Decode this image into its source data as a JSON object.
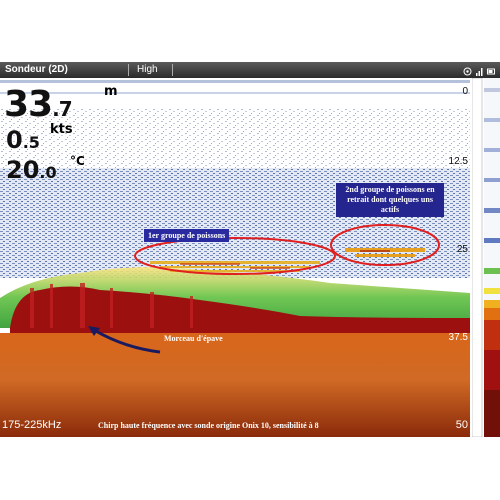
{
  "window": {
    "title": "Sondeur (2D)",
    "mode": "High",
    "icons": [
      "gps-icon",
      "signal-icon",
      "battery-icon"
    ]
  },
  "readouts": {
    "depth_int": "33",
    "depth_dec": ".7",
    "depth_unit": "m",
    "speed_int": "0",
    "speed_dec": ".5",
    "speed_unit": "kts",
    "temp_int": "20",
    "temp_dec": ".0",
    "temp_unit": "°C"
  },
  "depth_scale": [
    "0",
    "12.5",
    "25",
    "37.5"
  ],
  "range_bottom": "50",
  "frequency": "175-225kHz",
  "footnote": "Chirp haute fréquence avec sonde origine Onix 10, sensibilité à 8",
  "annotations": {
    "fish_group_1": "1er groupe de poissons",
    "fish_group_2": "2nd groupe de poissons en retrait dont quelques uns actifs",
    "wreck": "Morceau d'épave"
  },
  "colors": {
    "accent_circle": "#e02020",
    "annotation_box": "#2a2aa0",
    "arrow": "#1a1a60"
  }
}
